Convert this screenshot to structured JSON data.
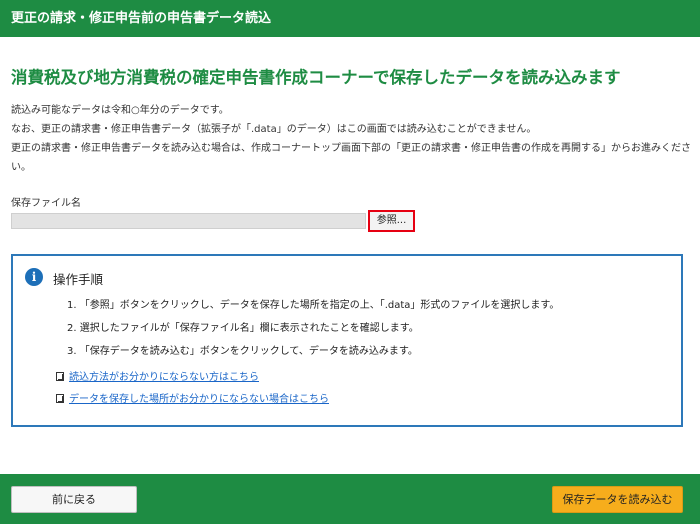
{
  "header": {
    "title": "更正の請求・修正申告前の申告書データ読込"
  },
  "main": {
    "heading": "消費税及び地方消費税の確定申告書作成コーナーで保存したデータを読み込みます",
    "description": [
      "読込み可能なデータは令和○年分のデータです。",
      "なお、更正の請求書・修正申告書データ（拡張子が「.data」のデータ）はこの画面では読み込むことができません。",
      "更正の請求書・修正申告書データを読み込む場合は、作成コーナートップ画面下部の「更正の請求書・修正申告書の作成を再開する」からお進みください。"
    ],
    "file_label": "保存ファイル名",
    "file_value": "",
    "browse_label": "参照..."
  },
  "panel": {
    "title": "操作手順",
    "icon": "info-icon",
    "steps": [
      "1. 「参照」ボタンをクリックし、データを保存した場所を指定の上、「.data」形式のファイルを選択します。",
      "2. 選択したファイルが「保存ファイル名」欄に表示されたことを確認します。",
      "3. 「保存データを読み込む」ボタンをクリックして、データを読み込みます。"
    ],
    "links": [
      "読込方法がお分かりにならない方はこちら",
      "データを保存した場所がお分かりにならない場合はこちら"
    ]
  },
  "footer": {
    "back_label": "前に戻る",
    "load_label": "保存データを読み込む"
  },
  "colors": {
    "brand_green": "#1e8c43",
    "link_blue": "#1a66c8",
    "accent_orange": "#f6ad1c",
    "highlight_red": "#e60012",
    "panel_border": "#2d78b9"
  }
}
